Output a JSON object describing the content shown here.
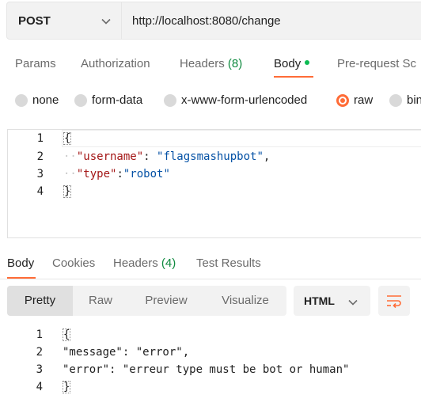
{
  "request": {
    "method": "POST",
    "url": "http://localhost:8080/change"
  },
  "request_tabs": [
    {
      "label": "Params"
    },
    {
      "label": "Authorization"
    },
    {
      "label": "Headers",
      "count": "(8)"
    },
    {
      "label": "Body"
    },
    {
      "label": "Pre-request Sc"
    }
  ],
  "body_types": [
    {
      "label": "none"
    },
    {
      "label": "form-data"
    },
    {
      "label": "x-www-form-urlencoded"
    },
    {
      "label": "raw",
      "selected": true
    },
    {
      "label": "bin"
    }
  ],
  "request_body": {
    "line_numbers": [
      "1",
      "2",
      "3",
      "4"
    ],
    "open_brace": "{",
    "close_brace": "}",
    "key1": "\"username\"",
    "sep1": ": ",
    "val1": "\"flagsmashupbot\"",
    "comma1": ",",
    "key2": "\"type\"",
    "sep2": ":",
    "val2": "\"robot\""
  },
  "response_tabs": [
    {
      "label": "Body"
    },
    {
      "label": "Cookies"
    },
    {
      "label": "Headers",
      "count": "(4)"
    },
    {
      "label": "Test Results"
    }
  ],
  "format_tabs": [
    "Pretty",
    "Raw",
    "Preview",
    "Visualize"
  ],
  "format_select": "HTML",
  "response_body": {
    "line_numbers": [
      "1",
      "2",
      "3",
      "4"
    ],
    "open_brace": "{",
    "line2": "\"message\": \"error\",",
    "line3": "\"error\": \"erreur type must be bot or human\"",
    "close_brace": "}"
  },
  "colors": {
    "accent": "#ff6c37",
    "count_green": "#0f8a3f",
    "dot_green": "#0cbb52"
  },
  "icons": [
    "chevron-down-icon",
    "wrap-lines-icon"
  ]
}
